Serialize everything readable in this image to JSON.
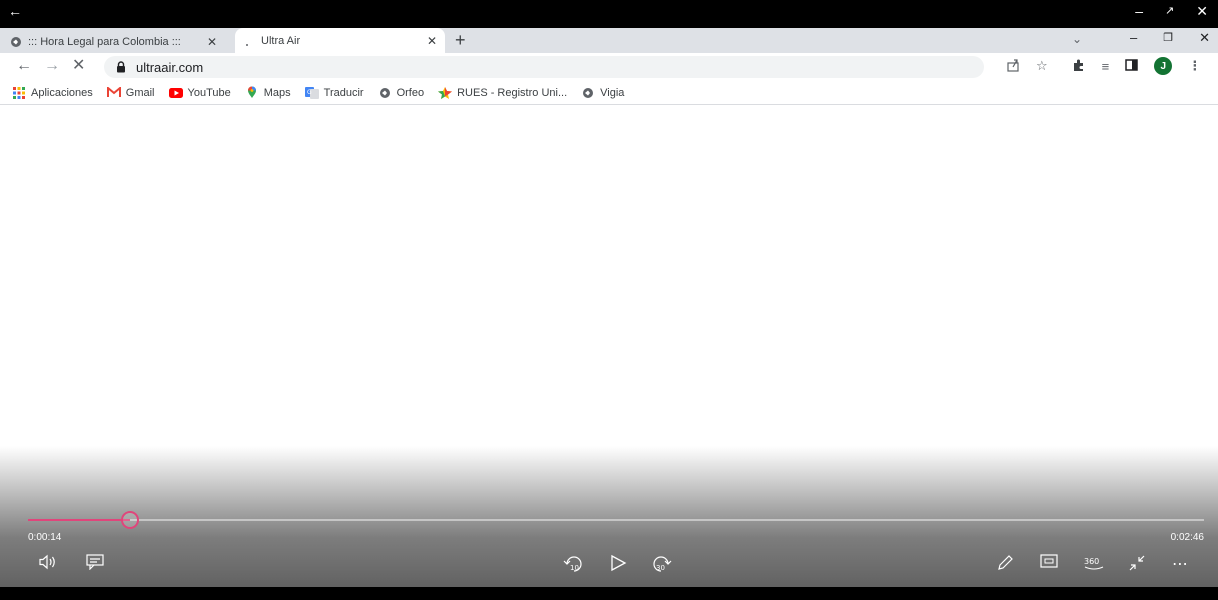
{
  "tabs": [
    {
      "title": "::: Hora Legal para Colombia :::"
    },
    {
      "title": "Ultra Air"
    }
  ],
  "address": {
    "url": "ultraair.com"
  },
  "bookmarks": [
    {
      "label": "Aplicaciones",
      "icon": "apps-grid-icon"
    },
    {
      "label": "Gmail",
      "icon": "gmail-icon"
    },
    {
      "label": "YouTube",
      "icon": "youtube-icon"
    },
    {
      "label": "Maps",
      "icon": "maps-pin-icon"
    },
    {
      "label": "Traducir",
      "icon": "translate-icon"
    },
    {
      "label": "Orfeo",
      "icon": "globe-icon"
    },
    {
      "label": "RUES - Registro Uni...",
      "icon": "rues-icon"
    },
    {
      "label": "Vigia",
      "icon": "globe-icon"
    }
  ],
  "profile": {
    "initial": "J"
  },
  "player": {
    "current_time": "0:00:14",
    "total_time": "0:02:46",
    "progress": 0.087,
    "accent": "#e0457b",
    "skip_back_label": "10",
    "skip_forward_label": "30",
    "view_360_label": "360"
  }
}
